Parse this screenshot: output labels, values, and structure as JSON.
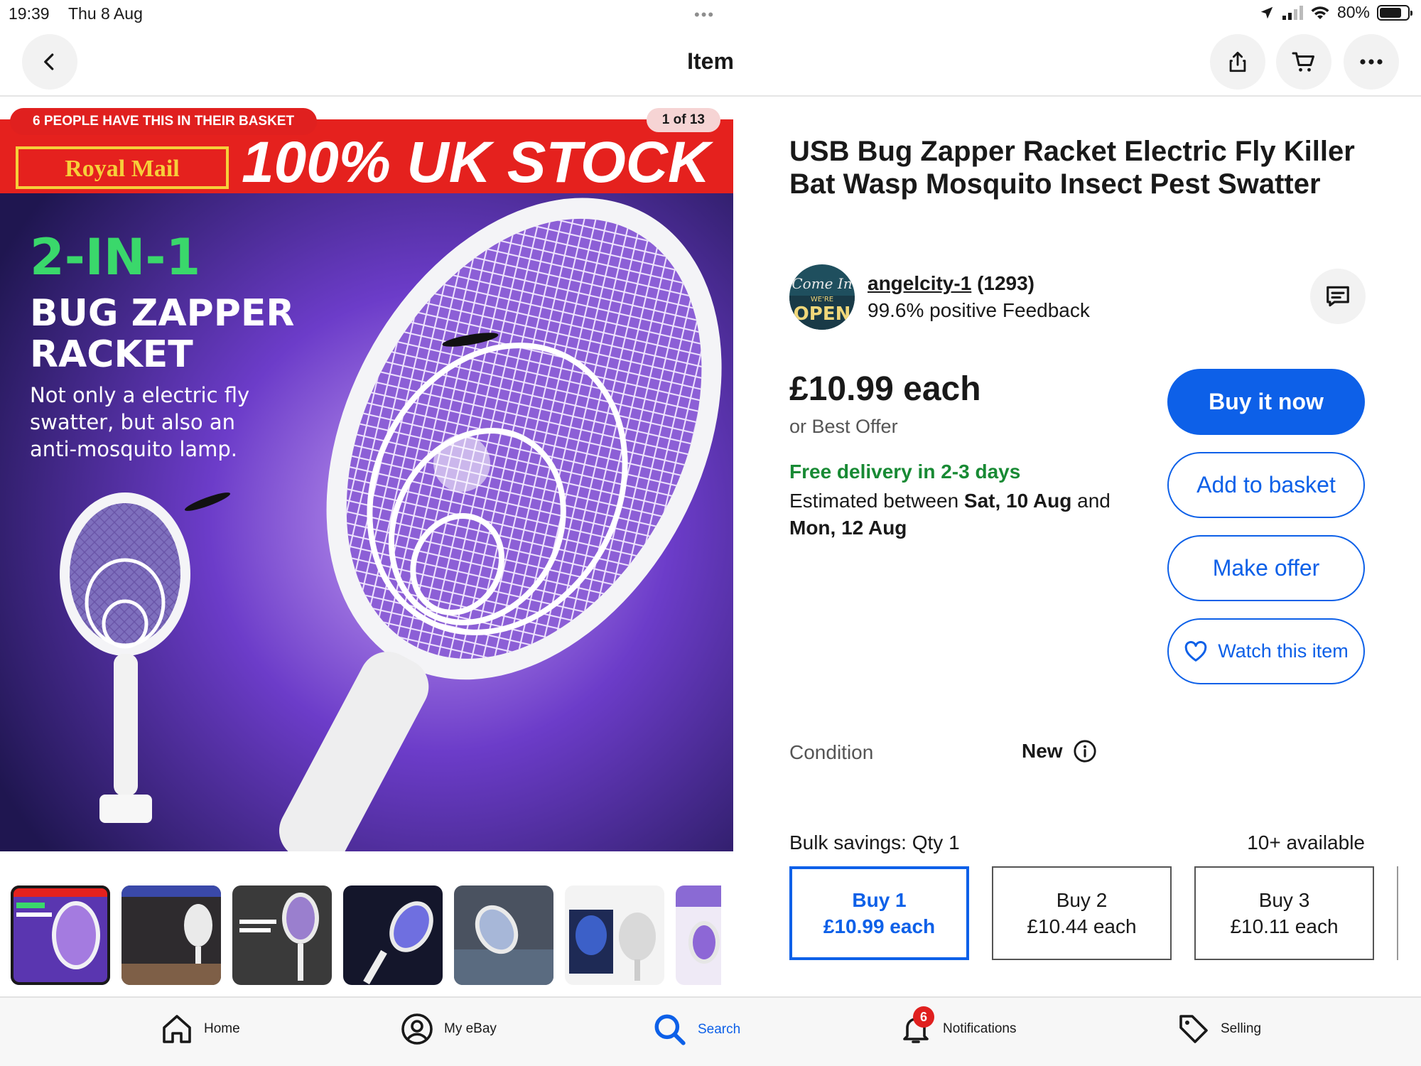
{
  "status_bar": {
    "time": "19:39",
    "date": "Thu 8 Aug",
    "battery": "80%",
    "battery_level": 0.8
  },
  "header": {
    "title": "Item",
    "icons": [
      "back-icon",
      "share-icon",
      "cart-icon",
      "more-icon"
    ]
  },
  "gallery": {
    "basket_badge": "6 PEOPLE HAVE THIS IN THEIR BASKET",
    "page_indicator": "1 of 13",
    "image": {
      "brand_text": "Royal Mail",
      "banner_text": "100% UK STOCK",
      "headline": "2-IN-1",
      "subheadline_1": "BUG ZAPPER",
      "subheadline_2": "RACKET",
      "tagline_1": "Not only a electric fly",
      "tagline_2": "swatter, but also an",
      "tagline_3": "anti-mosquito lamp."
    },
    "thumbnail_count": 7,
    "colors": {
      "banner_red": "#e0201f",
      "headline_green": "#3ad86b",
      "bg_purple": "#5b2fb0"
    }
  },
  "product": {
    "title": "USB Bug Zapper Racket Electric Fly Killer Bat Wasp Mosquito Insect Pest Swatter",
    "seller": {
      "name": "angelcity-1",
      "score": "(1293)",
      "feedback": "99.6% positive Feedback",
      "avatar_text_1": "Come In",
      "avatar_text_2": "WE'RE",
      "avatar_text_3": "OPEN"
    },
    "price": "£10.99 each",
    "best_offer": "or Best Offer",
    "delivery": {
      "free": "Free delivery in 2-3 days",
      "estimate_prefix": "Estimated between ",
      "date_from": "Sat, 10 Aug",
      "estimate_mid": " and",
      "date_to": "Mon, 12 Aug"
    },
    "condition_label": "Condition",
    "condition_value": "New"
  },
  "actions": {
    "buy_now": "Buy it now",
    "add_to_basket": "Add to basket",
    "make_offer": "Make offer",
    "watch": "Watch this item"
  },
  "bulk": {
    "label": "Bulk savings: Qty 1",
    "available": "10+ available",
    "options": [
      {
        "qty": "Buy 1",
        "price": "£10.99 each"
      },
      {
        "qty": "Buy 2",
        "price": "£10.44 each"
      },
      {
        "qty": "Buy 3",
        "price": "£10.11 each"
      }
    ]
  },
  "tabbar": {
    "items": [
      {
        "label": "Home",
        "icon": "home-icon"
      },
      {
        "label": "My eBay",
        "icon": "account-icon"
      },
      {
        "label": "Search",
        "icon": "search-icon"
      },
      {
        "label": "Notifications",
        "icon": "bell-icon",
        "badge": "6"
      },
      {
        "label": "Selling",
        "icon": "tag-icon"
      }
    ],
    "active_color": "#0d60e8"
  }
}
